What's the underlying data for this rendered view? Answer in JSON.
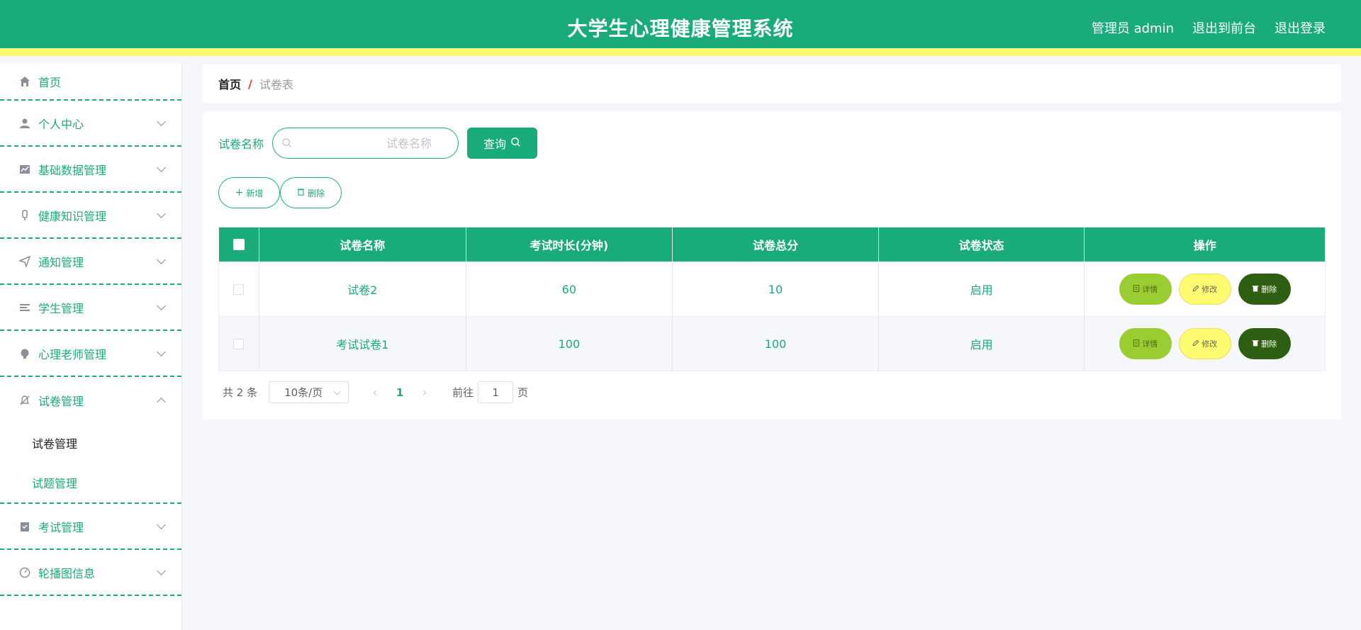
{
  "header": {
    "title": "大学生心理健康管理系统",
    "user": "管理员 admin",
    "to_front": "退出到前台",
    "logout": "退出登录"
  },
  "sidebar": {
    "items": [
      {
        "label": "首页",
        "icon": "home-icon"
      },
      {
        "label": "个人中心",
        "icon": "user-icon"
      },
      {
        "label": "基础数据管理",
        "icon": "chart-icon"
      },
      {
        "label": "健康知识管理",
        "icon": "microphone-icon"
      },
      {
        "label": "通知管理",
        "icon": "send-icon"
      },
      {
        "label": "学生管理",
        "icon": "list-icon"
      },
      {
        "label": "心理老师管理",
        "icon": "bulb-icon"
      },
      {
        "label": "试卷管理",
        "icon": "bell-off-icon"
      },
      {
        "label": "考试管理",
        "icon": "clipboard-icon"
      },
      {
        "label": "轮播图信息",
        "icon": "gauge-icon"
      }
    ],
    "submenu": {
      "paper_manage": "试卷管理",
      "question_manage": "试题管理"
    }
  },
  "breadcrumb": {
    "home": "首页",
    "separator": "/",
    "current": "试卷表"
  },
  "search": {
    "label": "试卷名称",
    "placeholder": "试卷名称",
    "value": "",
    "button": "查询"
  },
  "actions": {
    "add": "新增",
    "delete": "删除"
  },
  "table": {
    "headers": [
      "试卷名称",
      "考试时长(分钟)",
      "试卷总分",
      "试卷状态",
      "操作"
    ],
    "rows": [
      {
        "name": "试卷2",
        "duration": "60",
        "score": "10",
        "status": "启用"
      },
      {
        "name": "考试试卷1",
        "duration": "100",
        "score": "100",
        "status": "启用"
      }
    ],
    "ops": {
      "detail": "详情",
      "edit": "修改",
      "remove": "删除"
    }
  },
  "pager": {
    "total": "共 2 条",
    "size": "10条/页",
    "current_page": "1",
    "goto_prefix": "前往",
    "goto_value": "1",
    "goto_suffix": "页"
  },
  "colors": {
    "primary": "#1aab7a",
    "accent_bar": "#fffb71",
    "detail": "#9acd32",
    "edit": "#fffb71",
    "remove": "#2d5e12"
  }
}
